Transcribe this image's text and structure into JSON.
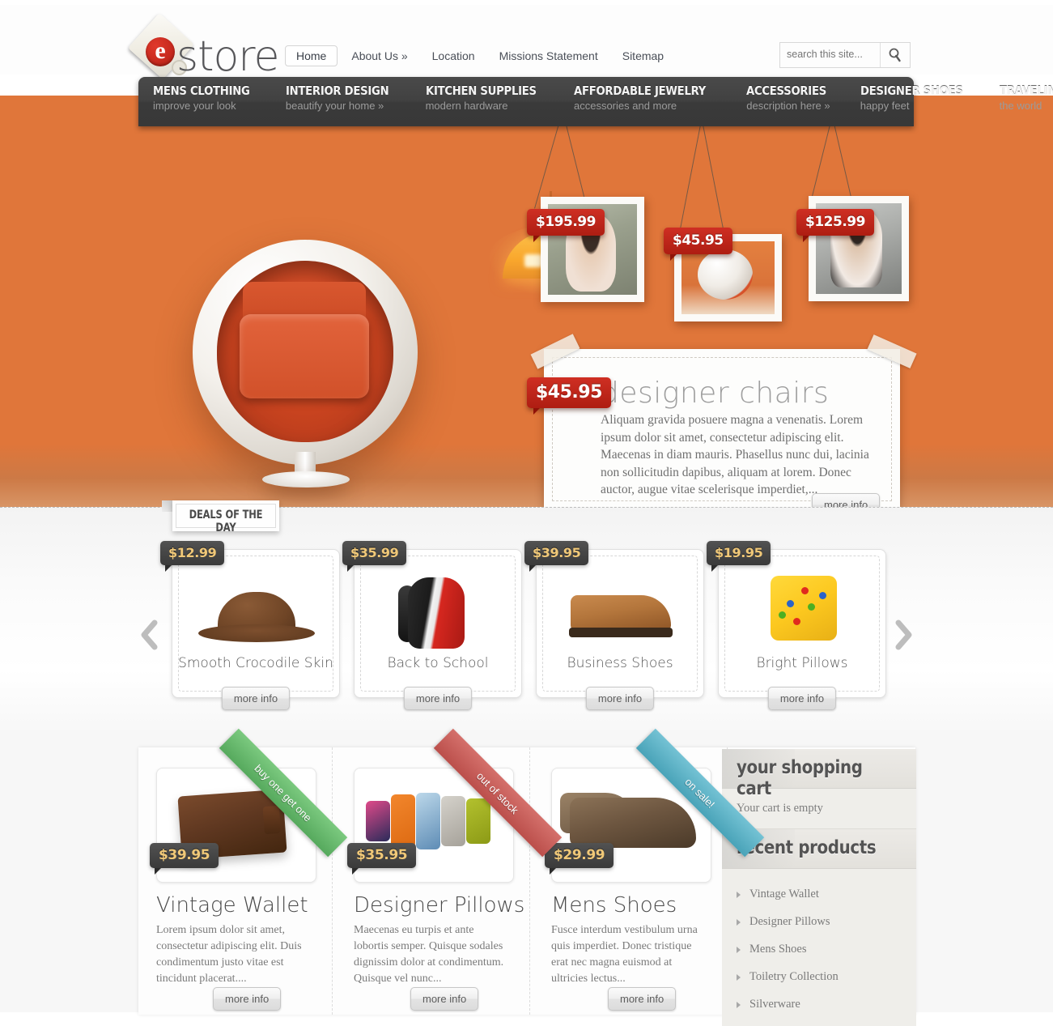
{
  "brand": {
    "name": "store",
    "logo_letter": "e"
  },
  "top_nav": [
    {
      "label": "Home",
      "active": true
    },
    {
      "label": "About Us »",
      "active": false
    },
    {
      "label": "Location",
      "active": false
    },
    {
      "label": "Missions Statement",
      "active": false
    },
    {
      "label": "Sitemap",
      "active": false
    }
  ],
  "search": {
    "placeholder": "search this site...",
    "value": "",
    "icon": "search-icon"
  },
  "main_nav": [
    {
      "title": "MENS CLOTHING",
      "sub": "improve your look"
    },
    {
      "title": "INTERIOR DESIGN",
      "sub": "beautify your home »"
    },
    {
      "title": "KITCHEN SUPPLIES",
      "sub": "modern hardware"
    },
    {
      "title": "AFFORDABLE JEWELRY",
      "sub": "accessories and more"
    },
    {
      "title": "ACCESSORIES",
      "sub": "description here »"
    },
    {
      "title": "DESIGNER SHOES",
      "sub": "happy feet"
    },
    {
      "title": "TRAVELING",
      "sub": "the world"
    }
  ],
  "hero": {
    "hanging_prices": [
      "$195.99",
      "$45.95",
      "$125.99"
    ],
    "price": "$45.95",
    "title": "designer chairs",
    "description": "Aliquam gravida posuere magna a venenatis. Lorem ipsum dolor sit amet, consectetur adipiscing elit. Maecenas in diam mauris. Phasellus nunc dui, lacinia non sollicitudin dapibus, aliquam at lorem. Donec auctor, augue vitae scelerisque imperdiet,...",
    "more_info": "more info"
  },
  "deals": {
    "label": "DEALS OF THE DAY",
    "prev_icon": "chevron-left-icon",
    "next_icon": "chevron-right-icon",
    "items": [
      {
        "price": "$12.99",
        "name": "Smooth Crocodile Skin",
        "more_info": "more info"
      },
      {
        "price": "$35.99",
        "name": "Back to School",
        "more_info": "more info"
      },
      {
        "price": "$39.95",
        "name": "Business Shoes",
        "more_info": "more info"
      },
      {
        "price": "$19.95",
        "name": "Bright Pillows",
        "more_info": "more info"
      }
    ]
  },
  "products": [
    {
      "price": "$39.95",
      "title": "Vintage Wallet",
      "description": "Lorem ipsum dolor sit amet, consectetur adipiscing elit. Duis condimentum justo vitae est tincidunt placerat....",
      "more_info": "more info",
      "ribbon": "buy one get one",
      "ribbon_color": "#63b86a"
    },
    {
      "price": "$35.95",
      "title": "Designer Pillows",
      "description": "Maecenas eu turpis et ante lobortis semper. Quisque sodales dignissim dolor at condimentum. Quisque vel nunc...",
      "more_info": "more info",
      "ribbon": "out of stock",
      "ribbon_color": "#c45c58"
    },
    {
      "price": "$29.99",
      "title": "Mens Shoes",
      "description": "Fusce interdum vestibulum urna quis imperdiet. Donec tristique erat nec magna euismod at ultricies lectus...",
      "more_info": "more info",
      "ribbon": "on sale!",
      "ribbon_color": "#59b0c4"
    }
  ],
  "sidebar": {
    "cart_title": "your shopping cart",
    "cart_empty": "Your cart is empty",
    "recent_title": "recent products",
    "recent_items": [
      {
        "label": "Vintage Wallet"
      },
      {
        "label": "Designer Pillows"
      },
      {
        "label": "Mens Shoes"
      },
      {
        "label": "Toiletry Collection"
      },
      {
        "label": "Silverware"
      }
    ]
  },
  "colors": {
    "hero_orange": "#e0763a",
    "nav_dark": "#414141",
    "price_red": "#be2317",
    "price_dark": "#454545",
    "price_gold": "#f0c878"
  }
}
